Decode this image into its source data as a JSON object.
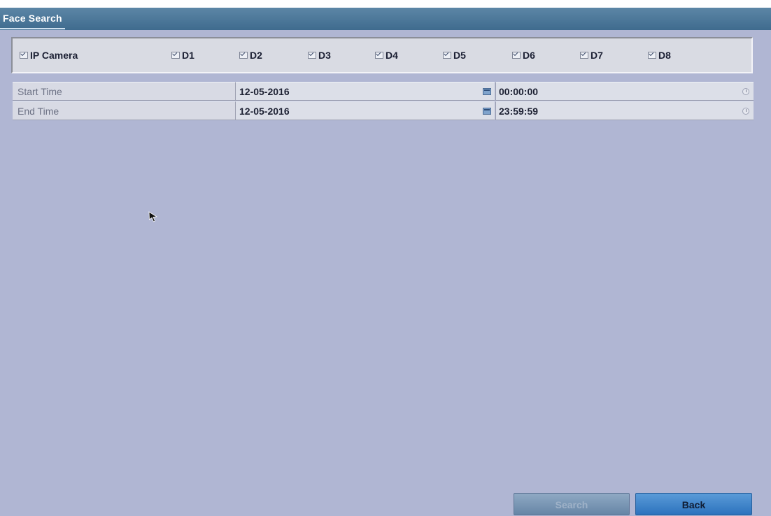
{
  "title": "Face Search",
  "channels": [
    {
      "label": "IP Camera",
      "checked": true
    },
    {
      "label": "D1",
      "checked": true
    },
    {
      "label": "D2",
      "checked": true
    },
    {
      "label": "D3",
      "checked": true
    },
    {
      "label": "D4",
      "checked": true
    },
    {
      "label": "D5",
      "checked": true
    },
    {
      "label": "D6",
      "checked": true
    },
    {
      "label": "D7",
      "checked": true
    },
    {
      "label": "D8",
      "checked": true
    }
  ],
  "start": {
    "label": "Start Time",
    "date": "12-05-2016",
    "time": "00:00:00"
  },
  "end": {
    "label": "End Time",
    "date": "12-05-2016",
    "time": "23:59:59"
  },
  "buttons": {
    "search": "Search",
    "back": "Back"
  },
  "icons": {
    "calendar": "calendar-icon",
    "clock": "clock-icon",
    "checkbox": "checkbox-checked-icon"
  },
  "colors": {
    "titlebar": "#4a7597",
    "background": "#b0b6d3",
    "back_button": "#3b82c9"
  }
}
